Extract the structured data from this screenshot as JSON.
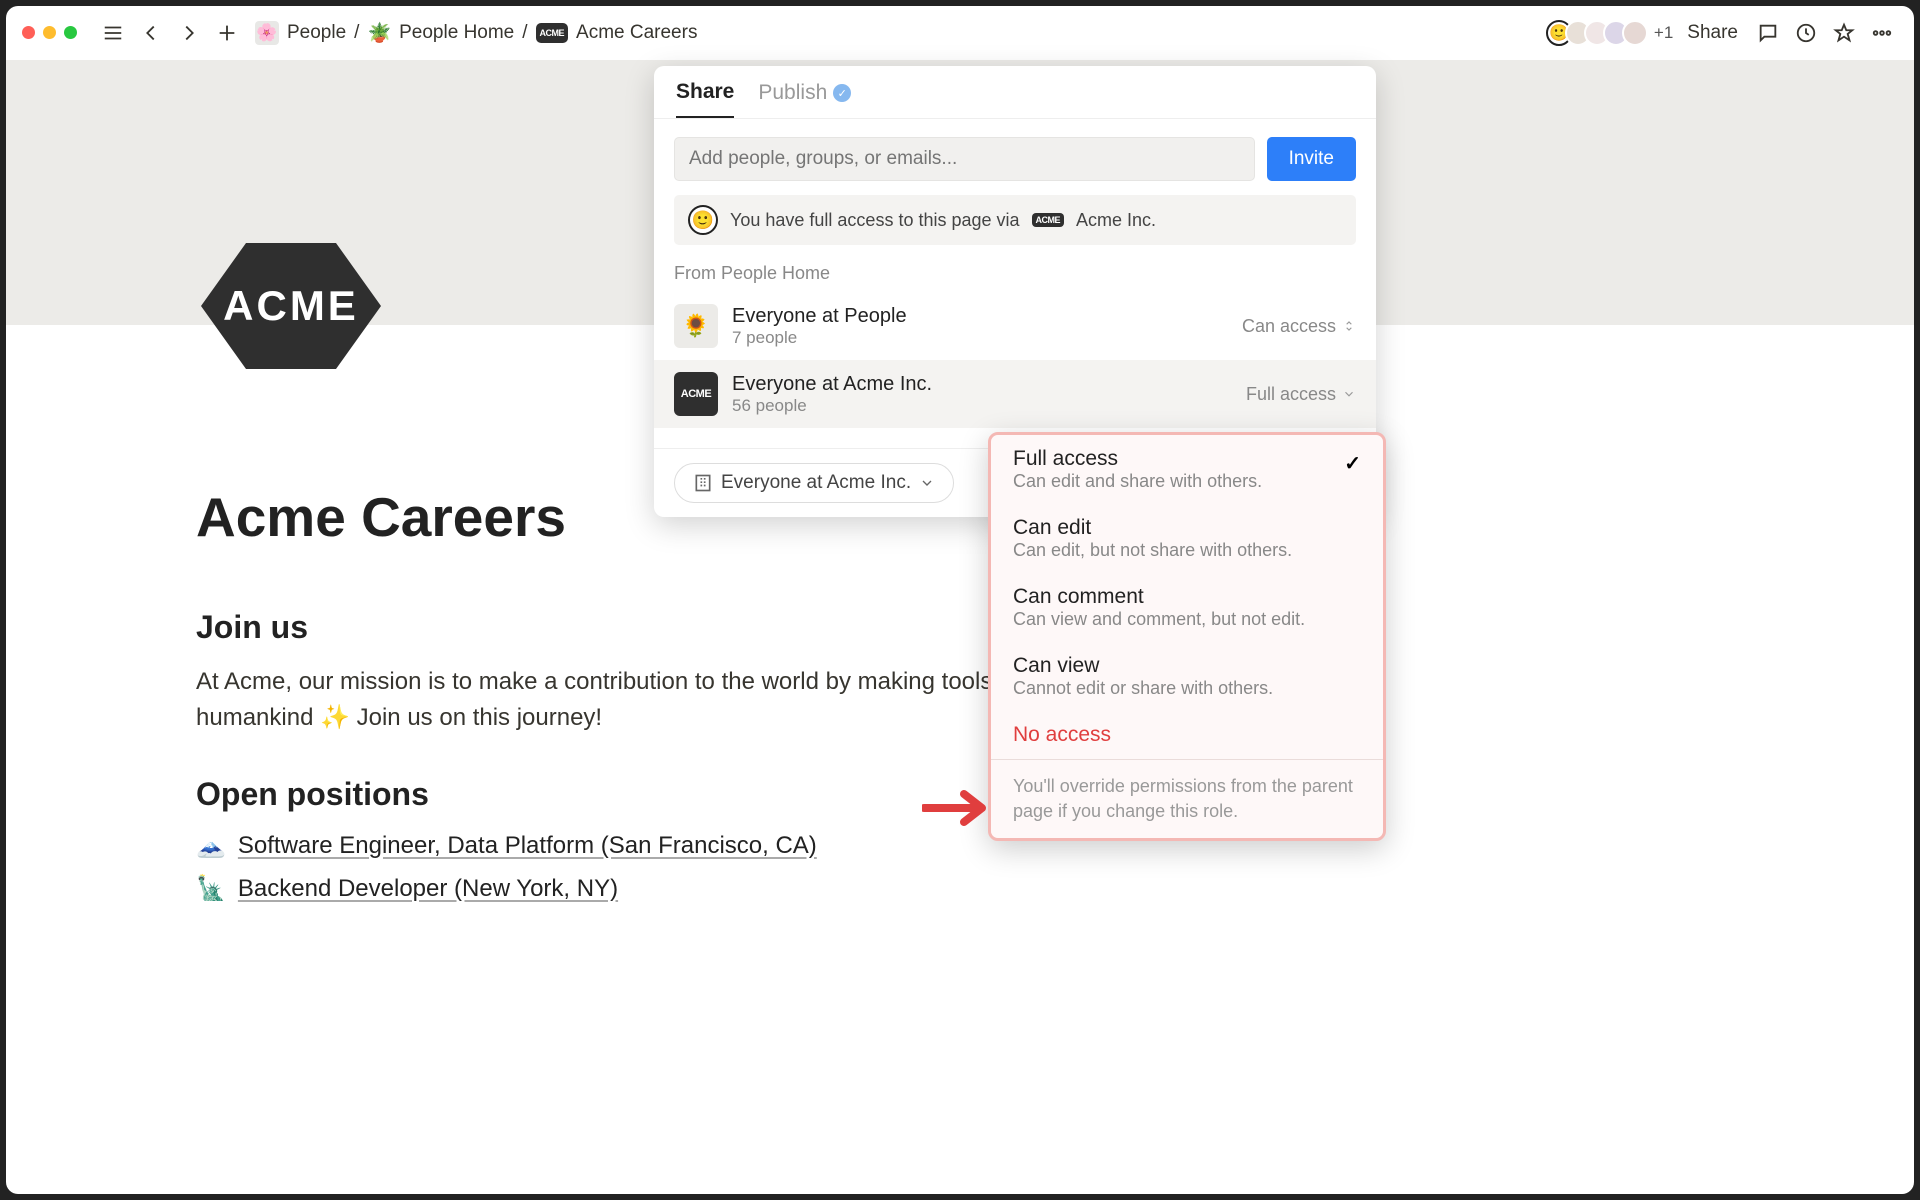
{
  "breadcrumb": {
    "seg1": "People",
    "seg2": "People Home",
    "seg3": "Acme Careers",
    "sep": "/",
    "plant_emoji": "🪴",
    "flower_emoji": "🌸"
  },
  "topbar": {
    "plus_n": "+1",
    "share": "Share"
  },
  "page": {
    "logo_text": "ACME",
    "title": "Acme Careers",
    "join_h": "Join us",
    "join_p": "At Acme, our mission is to make a contribution to the world by making tools for the mind that advance humankind ✨ Join us on this journey!",
    "open_h": "Open positions",
    "pos": [
      {
        "emoji": "🗻",
        "text": "Software Engineer, Data Platform (San Francisco, CA)"
      },
      {
        "emoji": "🗽",
        "text": "Backend Developer (New York, NY)"
      }
    ]
  },
  "share": {
    "tab_share": "Share",
    "tab_publish": "Publish",
    "placeholder": "Add people, groups, or emails...",
    "invite": "Invite",
    "access_note_pre": "You have full access to this page via",
    "access_note_org": "Acme Inc.",
    "from": "From People Home",
    "rows": [
      {
        "icon": "🌻",
        "name": "Everyone at People",
        "sub": "7 people",
        "level": "Can access"
      },
      {
        "icon": "ACME",
        "name": "Everyone at Acme Inc.",
        "sub": "56 people",
        "level": "Full access"
      }
    ],
    "chip": "Everyone at Acme Inc."
  },
  "roles": {
    "items": [
      {
        "t": "Full access",
        "d": "Can edit and share with others.",
        "chk": true
      },
      {
        "t": "Can edit",
        "d": "Can edit, but not share with others."
      },
      {
        "t": "Can comment",
        "d": "Can view and comment, but not edit."
      },
      {
        "t": "Can view",
        "d": "Cannot edit or share with others."
      },
      {
        "t": "No access",
        "red": true
      }
    ],
    "footer": "You'll override permissions from the parent page if you change this role."
  }
}
